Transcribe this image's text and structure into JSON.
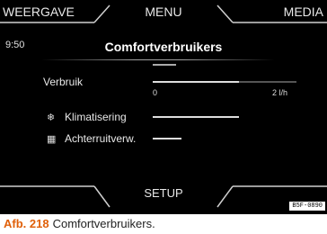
{
  "tabs": {
    "left": "WEERGAVE",
    "center": "MENU",
    "right": "MEDIA"
  },
  "time": "9:50",
  "title": "Comfortverbruikers",
  "consumption": {
    "label": "Verbruik",
    "min_label": "0",
    "max_label": "2 l/h",
    "fill_fraction": 0.6
  },
  "consumers": [
    {
      "icon": "snowflake-icon",
      "glyph": "❄",
      "label": "Klimatisering",
      "fraction": 0.6
    },
    {
      "icon": "rear-window-heating-icon",
      "glyph": "▦",
      "label": "Achterruitverw.",
      "fraction": 0.2
    }
  ],
  "bottom_button": "SETUP",
  "image_code": "B5F-0890",
  "caption": {
    "figure": "Afb. 218",
    "text": "Comfortverbruikers."
  },
  "colors": {
    "screen_bg": "#000000",
    "caption_accent": "#e0600a"
  }
}
